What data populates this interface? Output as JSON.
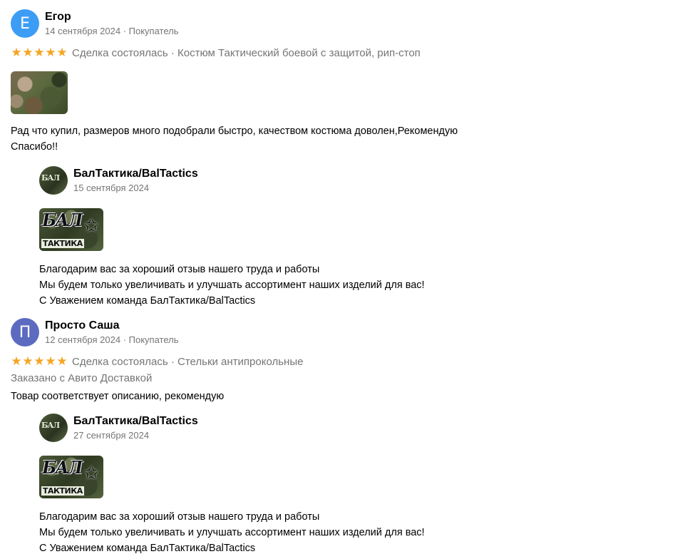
{
  "reviews": [
    {
      "avatar_letter": "Е",
      "avatar_color": "#3d9df5",
      "author": "Егор",
      "meta": "14 сентября 2024 · Покупатель",
      "stars": 5,
      "deal": "Сделка состоялась · Костюм Тактический боевой с защитой, рип-стоп",
      "text_lines": [
        "Рад что купил, размеров много подобрали быстро, качеством костюма доволен,Рекомендую",
        "Спасибо!!"
      ],
      "reply": {
        "author": "БалТактика/BalTactics",
        "date": "15 сентября 2024",
        "logo_top": "БАЛ",
        "logo_bottom": "ТАКТИКА",
        "lines": [
          "Благодарим вас за хороший отзыв нашего труда и работы",
          "Мы будем только увеличивать и улучшать ассортимент наших изделий для вас!",
          "С Уважением команда БалТактика/BalTactics"
        ]
      }
    },
    {
      "avatar_letter": "П",
      "avatar_color": "#5c6bc0",
      "author": "Просто Саша",
      "meta": "12 сентября 2024 · Покупатель",
      "stars": 5,
      "deal": "Сделка состоялась · Стельки антипрокольные",
      "delivery": "Заказано с Авито Доставкой",
      "text_lines": [
        "Товар соответствует описанию, рекомендую"
      ],
      "reply": {
        "author": "БалТактика/BalTactics",
        "date": "27 сентября 2024",
        "logo_top": "БАЛ",
        "logo_bottom": "ТАКТИКА",
        "lines": [
          "Благодарим вас за хороший отзыв нашего труда и работы",
          "Мы будем только увеличивать и улучшать ассортимент наших изделий для вас!",
          "С Уважением команда БалТактика/BalTactics"
        ]
      }
    }
  ],
  "star_glyph": "★",
  "star_color": "#f5a524"
}
